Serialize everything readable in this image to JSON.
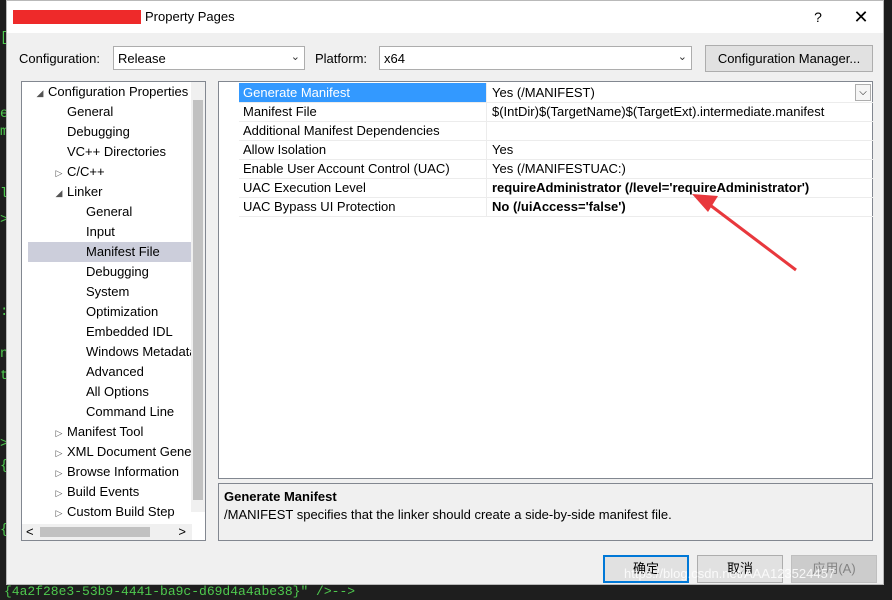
{
  "window": {
    "title": "Property Pages",
    "help": "?",
    "close": "✕"
  },
  "toolbar": {
    "configuration_label": "Configuration:",
    "configuration_value": "Release",
    "platform_label": "Platform:",
    "platform_value": "x64",
    "config_manager": "Configuration Manager..."
  },
  "tree": {
    "items": [
      {
        "label": "Configuration Properties",
        "exp": "◢"
      },
      {
        "label": "General",
        "exp": ""
      },
      {
        "label": "Debugging",
        "exp": ""
      },
      {
        "label": "VC++ Directories",
        "exp": ""
      },
      {
        "label": "C/C++",
        "exp": "▷"
      },
      {
        "label": "Linker",
        "exp": "◢"
      },
      {
        "label": "General",
        "exp": ""
      },
      {
        "label": "Input",
        "exp": ""
      },
      {
        "label": "Manifest File",
        "exp": ""
      },
      {
        "label": "Debugging",
        "exp": ""
      },
      {
        "label": "System",
        "exp": ""
      },
      {
        "label": "Optimization",
        "exp": ""
      },
      {
        "label": "Embedded IDL",
        "exp": ""
      },
      {
        "label": "Windows Metadata",
        "exp": ""
      },
      {
        "label": "Advanced",
        "exp": ""
      },
      {
        "label": "All Options",
        "exp": ""
      },
      {
        "label": "Command Line",
        "exp": ""
      },
      {
        "label": "Manifest Tool",
        "exp": "▷"
      },
      {
        "label": "XML Document Generator",
        "exp": "▷"
      },
      {
        "label": "Browse Information",
        "exp": "▷"
      },
      {
        "label": "Build Events",
        "exp": "▷"
      },
      {
        "label": "Custom Build Step",
        "exp": "▷"
      }
    ],
    "scroll_left": "<",
    "scroll_right": ">"
  },
  "grid": {
    "rows": [
      {
        "name": "Generate Manifest",
        "value": "Yes (/MANIFEST)"
      },
      {
        "name": "Manifest File",
        "value": "$(IntDir)$(TargetName)$(TargetExt).intermediate.manifest"
      },
      {
        "name": "Additional Manifest Dependencies",
        "value": ""
      },
      {
        "name": "Allow Isolation",
        "value": "Yes"
      },
      {
        "name": "Enable User Account Control (UAC)",
        "value": "Yes (/MANIFESTUAC:)"
      },
      {
        "name": "UAC Execution Level",
        "value": "requireAdministrator (/level='requireAdministrator')"
      },
      {
        "name": "UAC Bypass UI Protection",
        "value": "No (/uiAccess='false')"
      }
    ],
    "dropdown": "⌵"
  },
  "description": {
    "title": "Generate Manifest",
    "text": "/MANIFEST specifies that the linker should create a side-by-side manifest file."
  },
  "buttons": {
    "ok": "确定",
    "cancel": "取消",
    "apply": "应用(A)"
  },
  "background": {
    "bottom_line": "{4a2f28e3-53b9-4441-ba9c-d69d4a4abe38}\" />-->",
    "watermark": "https://blog.csdn.net/AAA123524457"
  },
  "colors": {
    "selection": "#3399ff",
    "tree_selection": "#cccedb",
    "annotation_arrow": "#e8383d"
  }
}
